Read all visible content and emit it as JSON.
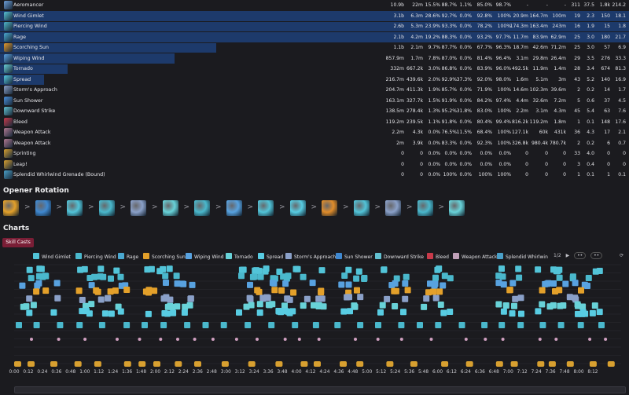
{
  "table": {
    "rows": [
      {
        "name": "Aeromancer",
        "icon": "aeromancer-icon",
        "color": "#6d9ed8",
        "share": 0.0,
        "cols": [
          "10.9b",
          "22m",
          "15.5%",
          "88.7%",
          "1.1%",
          "85.0%",
          "98.7%",
          "-",
          "-",
          "-",
          "311",
          "37.5",
          "1.8k",
          "214.2"
        ]
      },
      {
        "name": "Wind Gimlet",
        "icon": "wind-gimlet-icon",
        "color": "#57c3d6",
        "share": 1.0,
        "cols": [
          "3.1b",
          "6.3m",
          "28.6%",
          "92.7%",
          "0.0%",
          "92.8%",
          "100%",
          "20.9m",
          "164.7m",
          "100m",
          "19",
          "2.3",
          "150",
          "18.1"
        ]
      },
      {
        "name": "Piercing Wind",
        "icon": "piercing-wind-icon",
        "color": "#4fb6c9",
        "share": 1.0,
        "cols": [
          "2.6b",
          "5.3m",
          "23.9%",
          "93.3%",
          "0.0%",
          "78.2%",
          "100%",
          "174.3m",
          "163.4m",
          "243m",
          "16",
          "1.9",
          "15",
          "1.8"
        ]
      },
      {
        "name": "Rage",
        "icon": "rage-icon",
        "color": "#4aa8d0",
        "share": 1.0,
        "cols": [
          "2.1b",
          "4.2m",
          "19.2%",
          "88.3%",
          "0.0%",
          "93.2%",
          "97.7%",
          "11.7m",
          "83.9m",
          "62.9m",
          "25",
          "3.0",
          "180",
          "21.7"
        ]
      },
      {
        "name": "Scorching Sun",
        "icon": "scorching-sun-icon",
        "color": "#e79a2c",
        "share": 0.344,
        "cols": [
          "1.1b",
          "2.1m",
          "9.7%",
          "87.7%",
          "0.0%",
          "67.7%",
          "96.3%",
          "18.7m",
          "42.6m",
          "71.2m",
          "25",
          "3.0",
          "57",
          "6.9"
        ]
      },
      {
        "name": "Wiping Wind",
        "icon": "wiping-wind-icon",
        "color": "#5aa0e0",
        "share": 0.277,
        "cols": [
          "857.9m",
          "1.7m",
          "7.8%",
          "87.0%",
          "0.0%",
          "81.4%",
          "96.4%",
          "3.1m",
          "29.8m",
          "26.4m",
          "29",
          "3.5",
          "276",
          "33.3"
        ]
      },
      {
        "name": "Tornado",
        "icon": "tornado-icon",
        "color": "#6ad0d8",
        "share": 0.107,
        "cols": [
          "332m",
          "667.2k",
          "3.0%",
          "86.8%",
          "0.0%",
          "83.9%",
          "96.0%",
          "492.5k",
          "11.9m",
          "1.4m",
          "28",
          "3.4",
          "674",
          "81.3"
        ]
      },
      {
        "name": "Spread",
        "icon": "spread-icon",
        "color": "#56c8e0",
        "share": 0.07,
        "cols": [
          "216.7m",
          "439.6k",
          "2.0%",
          "92.9%",
          "37.3%",
          "92.0%",
          "98.0%",
          "1.6m",
          "5.1m",
          "3m",
          "43",
          "5.2",
          "140",
          "16.9"
        ]
      },
      {
        "name": "Storm's Approach",
        "icon": "storms-approach-icon",
        "color": "#8ca0c8",
        "share": 0.0,
        "cols": [
          "204.7m",
          "411.3k",
          "1.9%",
          "85.7%",
          "0.0%",
          "71.9%",
          "100%",
          "14.6m",
          "102.3m",
          "39.6m",
          "2",
          "0.2",
          "14",
          "1.7"
        ]
      },
      {
        "name": "Sun Shower",
        "icon": "sun-shower-icon",
        "color": "#4a8ed8",
        "share": 0.0,
        "cols": [
          "163.1m",
          "327.7k",
          "1.5%",
          "91.9%",
          "0.0%",
          "84.2%",
          "97.4%",
          "4.4m",
          "32.6m",
          "7.2m",
          "5",
          "0.6",
          "37",
          "4.5"
        ]
      },
      {
        "name": "Downward Strike",
        "icon": "downward-strike-icon",
        "color": "#62c0d0",
        "share": 0.0,
        "cols": [
          "138.5m",
          "278.4k",
          "1.3%",
          "95.2%",
          "31.8%",
          "83.0%",
          "100%",
          "2.2m",
          "3.1m",
          "4.3m",
          "45",
          "5.4",
          "63",
          "7.6"
        ]
      },
      {
        "name": "Bleed",
        "icon": "bleed-icon",
        "color": "#c83a4a",
        "share": 0.0,
        "cols": [
          "119.2m",
          "239.5k",
          "1.1%",
          "91.8%",
          "0.0%",
          "80.4%",
          "99.4%",
          "816.2k",
          "119.2m",
          "1.8m",
          "1",
          "0.1",
          "148",
          "17.6"
        ]
      },
      {
        "name": "Weapon Attack",
        "icon": "weapon-attack-icon",
        "color": "#b07890",
        "share": 0.0,
        "cols": [
          "2.2m",
          "4.3k",
          "0.0%",
          "76.5%",
          "11.5%",
          "68.4%",
          "100%",
          "127.1k",
          "60k",
          "431k",
          "36",
          "4.3",
          "17",
          "2.1"
        ]
      },
      {
        "name": "Weapon Attack",
        "icon": "weapon-attack-icon",
        "color": "#b07890",
        "share": 0.0,
        "cols": [
          "2m",
          "3.9k",
          "0.0%",
          "83.3%",
          "0.0%",
          "92.3%",
          "100%",
          "326.8k",
          "980.4k",
          "780.7k",
          "2",
          "0.2",
          "6",
          "0.7"
        ]
      },
      {
        "name": "Sprinting",
        "icon": "sprinting-icon",
        "color": "#d8a030",
        "share": 0.0,
        "cols": [
          "0",
          "0",
          "0.0%",
          "0.0%",
          "0.0%",
          "0.0%",
          "0.0%",
          "0",
          "0",
          "0",
          "33",
          "4.0",
          "0",
          "0"
        ]
      },
      {
        "name": "Leap!",
        "icon": "leap-icon",
        "color": "#d8a030",
        "share": 0.0,
        "cols": [
          "0",
          "0",
          "0.0%",
          "0.0%",
          "0.0%",
          "0.0%",
          "0.0%",
          "0",
          "0",
          "0",
          "3",
          "0.4",
          "0",
          "0"
        ]
      },
      {
        "name": "Splendid Whirlwind Grenade (Bound)",
        "icon": "grenade-icon",
        "color": "#4aa0c8",
        "share": 0.0,
        "cols": [
          "0",
          "0",
          "0.0%",
          "100%",
          "0.0%",
          "100%",
          "100%",
          "0",
          "0",
          "0",
          "1",
          "0.1",
          "1",
          "0.1"
        ]
      }
    ]
  },
  "opener": {
    "title": "Opener Rotation",
    "separator": ">",
    "skills": [
      {
        "name": "scorching-sun-icon",
        "color": "#e3a02a"
      },
      {
        "name": "sun-shower-icon",
        "color": "#3f88d0"
      },
      {
        "name": "wind-gimlet-icon",
        "color": "#52c4d8"
      },
      {
        "name": "piercing-wind-icon",
        "color": "#4ab8cc"
      },
      {
        "name": "storms-approach-icon",
        "color": "#8aa0c8"
      },
      {
        "name": "tornado-icon",
        "color": "#68d2d8"
      },
      {
        "name": "piercing-wind-icon",
        "color": "#4ab8cc"
      },
      {
        "name": "wiping-wind-icon",
        "color": "#58a2e0"
      },
      {
        "name": "wind-gimlet-icon",
        "color": "#52c4d8"
      },
      {
        "name": "spread-icon",
        "color": "#58cce2"
      },
      {
        "name": "scorching-sun-icon",
        "color": "#e08c2a"
      },
      {
        "name": "wind-gimlet-icon",
        "color": "#52c4d8"
      },
      {
        "name": "storms-approach-icon",
        "color": "#8aa0c8"
      },
      {
        "name": "piercing-wind-icon",
        "color": "#4ab8cc"
      },
      {
        "name": "tornado-icon",
        "color": "#68d2d8"
      }
    ]
  },
  "charts": {
    "title": "Charts",
    "active_tab": "Skill Casts",
    "pager": "1/2",
    "legend": [
      {
        "label": "Wind Gimlet",
        "color": "#52c4d8"
      },
      {
        "label": "Piercing Wind",
        "color": "#4ab8cc"
      },
      {
        "label": "Rage",
        "color": "#4aa8d0"
      },
      {
        "label": "Scorching Sun",
        "color": "#e3a02a"
      },
      {
        "label": "Wiping Wind",
        "color": "#58a2e0"
      },
      {
        "label": "Tornado",
        "color": "#68d2d8"
      },
      {
        "label": "Spread",
        "color": "#58cce2"
      },
      {
        "label": "Storm's Approach",
        "color": "#8aa0c8"
      },
      {
        "label": "Sun Shower",
        "color": "#3f88d0"
      },
      {
        "label": "Downward Strike",
        "color": "#62c0d0"
      },
      {
        "label": "Bleed",
        "color": "#c83a4a"
      },
      {
        "label": "Weapon Attack",
        "color": "#c0a0b8"
      },
      {
        "label": "Splendid Whirlwin",
        "color": "#4aa0c8"
      }
    ],
    "axis_ticks": [
      "0:00",
      "0:12",
      "0:24",
      "0:36",
      "0:48",
      "1:00",
      "1:12",
      "1:24",
      "1:36",
      "1:48",
      "2:00",
      "2:12",
      "2:24",
      "2:36",
      "2:48",
      "3:00",
      "3:12",
      "3:24",
      "3:36",
      "3:48",
      "4:00",
      "4:12",
      "4:24",
      "4:36",
      "4:48",
      "5:00",
      "5:12",
      "5:24",
      "5:36",
      "5:48",
      "6:00",
      "6:12",
      "6:24",
      "6:36",
      "6:48",
      "7:00",
      "7:12",
      "7:24",
      "7:36",
      "7:48",
      "8:00",
      "8:12"
    ]
  }
}
